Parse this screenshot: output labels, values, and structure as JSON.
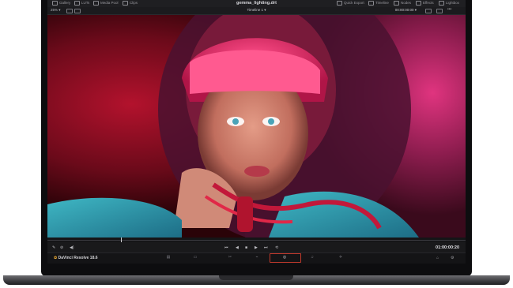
{
  "topbar": {
    "left_items": [
      "Gallery",
      "LUTs",
      "Media Pool",
      "Clips"
    ],
    "file_title": "gemma_lighting.drt",
    "right_items": [
      "Quick Export",
      "Timeline",
      "Nodes",
      "Effects",
      "Lightbox"
    ]
  },
  "subbar": {
    "zoom": "25% ▾",
    "timeline": "Timeline 1 ▾",
    "timecode": "00:00:00:00 ▾"
  },
  "transport": {
    "timecode": "01:00:00:20",
    "buttons": [
      "⏮",
      "◀",
      "■",
      "▶",
      "⏭",
      "⟲"
    ]
  },
  "pagebar": {
    "brand": "DaVinci Resolve 18.6",
    "pages": [
      "▤",
      "▭",
      "✂",
      "⌁",
      "◎",
      "♫",
      "✈"
    ],
    "active_page_index": 4
  },
  "colors": {
    "accent_active": "#c0392b",
    "bg": "#19191b"
  }
}
